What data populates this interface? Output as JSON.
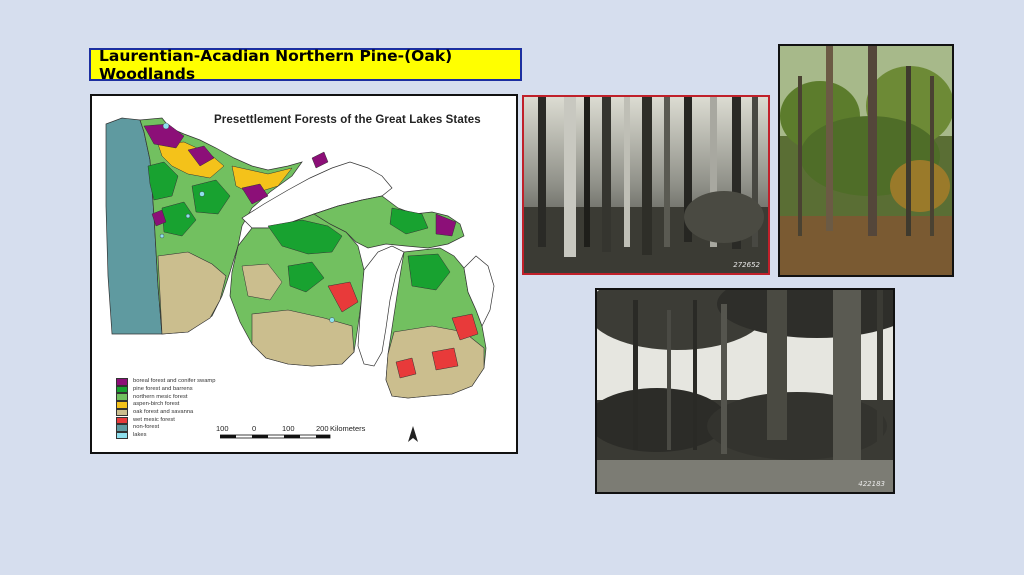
{
  "slide": {
    "title": "Laurentian-Acadian Northern Pine-(Oak) Woodlands"
  },
  "map": {
    "title": "Presettlement Forests of the Great Lakes States",
    "legend": [
      {
        "label": "boreal forest and conifer swamp",
        "color": "#8c0f78"
      },
      {
        "label": "pine forest and barrens",
        "color": "#18a230"
      },
      {
        "label": "northern mesic forest",
        "color": "#72c060"
      },
      {
        "label": "aspen-birch forest",
        "color": "#f4c21a"
      },
      {
        "label": "oak forest and savanna",
        "color": "#cbbe8e"
      },
      {
        "label": "wet mesic forest",
        "color": "#e83a3a"
      },
      {
        "label": "non-forest",
        "color": "#5f9aa0"
      },
      {
        "label": "lakes",
        "color": "#8fe0ee"
      }
    ],
    "scale": {
      "ticks": [
        "100",
        "0",
        "100",
        "200"
      ],
      "unit": "Kilometers"
    },
    "north_symbol": "north-arrow"
  },
  "photos": [
    {
      "name": "historic pine forest photo",
      "code": "272652"
    },
    {
      "name": "color pine woodland photo",
      "code": ""
    },
    {
      "name": "historic pine barrens photo",
      "code": "422183"
    }
  ]
}
